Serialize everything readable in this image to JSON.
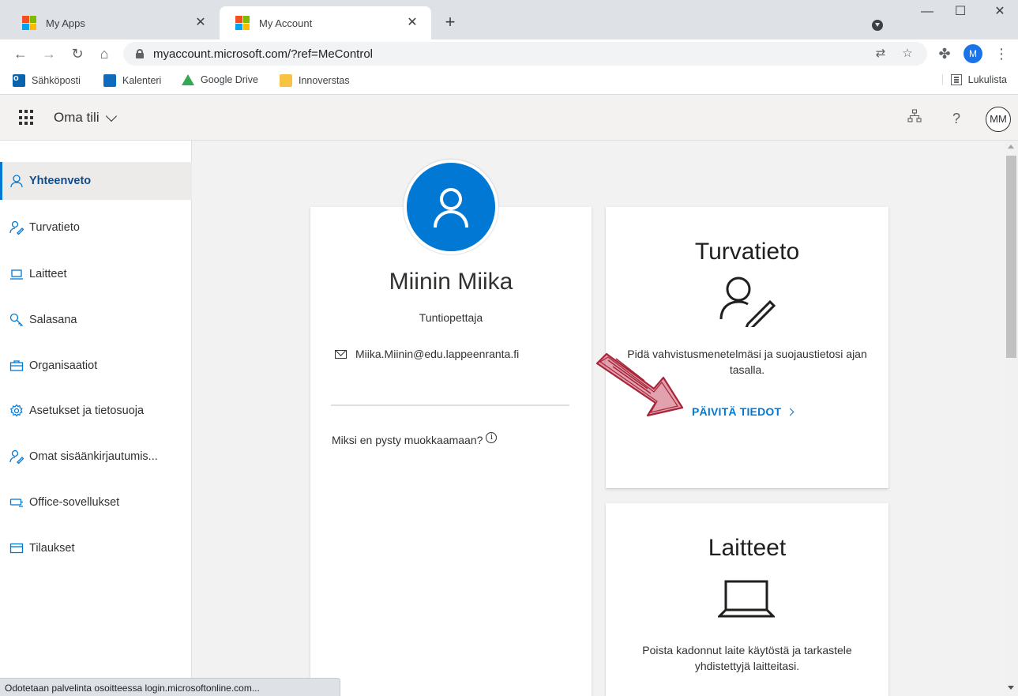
{
  "browser": {
    "tabs": [
      {
        "title": "My Apps",
        "active": false
      },
      {
        "title": "My Account",
        "active": true
      }
    ],
    "url": "myaccount.microsoft.com/?ref=MeControl",
    "profile_initial": "M",
    "bookmarks": [
      {
        "label": "Sähköposti",
        "icon": "outlook-icon"
      },
      {
        "label": "Kalenteri",
        "icon": "calendar-icon"
      },
      {
        "label": "Google Drive",
        "icon": "google-drive-icon"
      },
      {
        "label": "Innoverstas",
        "icon": "folder-icon"
      }
    ],
    "reading_list": "Lukulista",
    "status_text": "Odotetaan palvelinta osoitteessa login.microsoftonline.com..."
  },
  "header": {
    "title": "Oma tili",
    "avatar_initials": "MM",
    "help_glyph": "?"
  },
  "sidebar": {
    "items": [
      {
        "label": "Yhteenveto",
        "icon": "person-icon",
        "selected": true
      },
      {
        "label": "Turvatieto",
        "icon": "person-key-icon",
        "selected": false
      },
      {
        "label": "Laitteet",
        "icon": "laptop-icon",
        "selected": false
      },
      {
        "label": "Salasana",
        "icon": "key-icon",
        "selected": false
      },
      {
        "label": "Organisaatiot",
        "icon": "briefcase-icon",
        "selected": false
      },
      {
        "label": "Asetukset ja tietosuoja",
        "icon": "gear-icon",
        "selected": false
      },
      {
        "label": "Omat sisäänkirjautumis...",
        "icon": "person-sign-in-icon",
        "selected": false
      },
      {
        "label": "Office-sovellukset",
        "icon": "office-apps-icon",
        "selected": false
      },
      {
        "label": "Tilaukset",
        "icon": "credit-card-icon",
        "selected": false
      }
    ]
  },
  "profile": {
    "name": "Miinin Miika",
    "role": "Tuntiopettaja",
    "email": "Miika.Miinin@edu.lappeenranta.fi",
    "why_text": "Miksi en pysty muokkaamaan?",
    "info_glyph": "i"
  },
  "security_card": {
    "title": "Turvatieto",
    "description": "Pidä vahvistusmenetelmäsi ja suojaustietosi ajan tasalla.",
    "link": "PÄIVITÄ TIEDOT"
  },
  "devices_card": {
    "title": "Laitteet",
    "description": "Poista kadonnut laite käytöstä ja tarkastele yhdistettyjä laitteitasi."
  },
  "colors": {
    "accent": "#0078d4",
    "annotation_arrow": "#a8263b"
  }
}
